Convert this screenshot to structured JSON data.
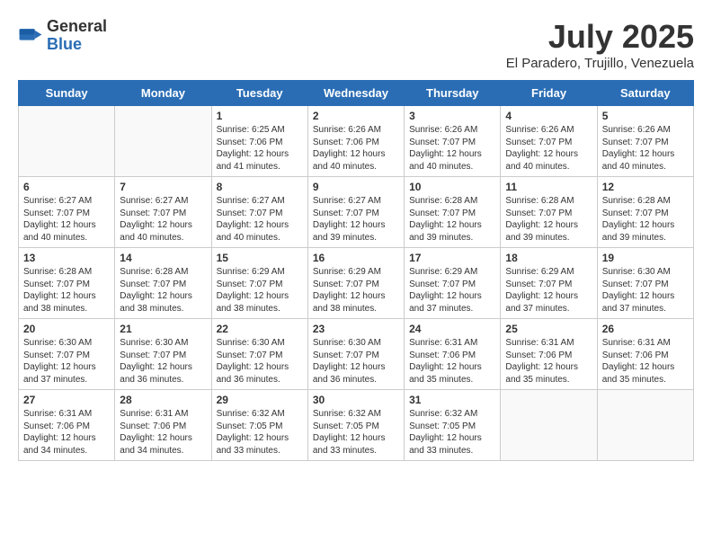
{
  "logo": {
    "general": "General",
    "blue": "Blue"
  },
  "title": "July 2025",
  "location": "El Paradero, Trujillo, Venezuela",
  "days_of_week": [
    "Sunday",
    "Monday",
    "Tuesday",
    "Wednesday",
    "Thursday",
    "Friday",
    "Saturday"
  ],
  "weeks": [
    [
      {
        "day": "",
        "info": ""
      },
      {
        "day": "",
        "info": ""
      },
      {
        "day": "1",
        "info": "Sunrise: 6:25 AM\nSunset: 7:06 PM\nDaylight: 12 hours and 41 minutes."
      },
      {
        "day": "2",
        "info": "Sunrise: 6:26 AM\nSunset: 7:06 PM\nDaylight: 12 hours and 40 minutes."
      },
      {
        "day": "3",
        "info": "Sunrise: 6:26 AM\nSunset: 7:07 PM\nDaylight: 12 hours and 40 minutes."
      },
      {
        "day": "4",
        "info": "Sunrise: 6:26 AM\nSunset: 7:07 PM\nDaylight: 12 hours and 40 minutes."
      },
      {
        "day": "5",
        "info": "Sunrise: 6:26 AM\nSunset: 7:07 PM\nDaylight: 12 hours and 40 minutes."
      }
    ],
    [
      {
        "day": "6",
        "info": "Sunrise: 6:27 AM\nSunset: 7:07 PM\nDaylight: 12 hours and 40 minutes."
      },
      {
        "day": "7",
        "info": "Sunrise: 6:27 AM\nSunset: 7:07 PM\nDaylight: 12 hours and 40 minutes."
      },
      {
        "day": "8",
        "info": "Sunrise: 6:27 AM\nSunset: 7:07 PM\nDaylight: 12 hours and 40 minutes."
      },
      {
        "day": "9",
        "info": "Sunrise: 6:27 AM\nSunset: 7:07 PM\nDaylight: 12 hours and 39 minutes."
      },
      {
        "day": "10",
        "info": "Sunrise: 6:28 AM\nSunset: 7:07 PM\nDaylight: 12 hours and 39 minutes."
      },
      {
        "day": "11",
        "info": "Sunrise: 6:28 AM\nSunset: 7:07 PM\nDaylight: 12 hours and 39 minutes."
      },
      {
        "day": "12",
        "info": "Sunrise: 6:28 AM\nSunset: 7:07 PM\nDaylight: 12 hours and 39 minutes."
      }
    ],
    [
      {
        "day": "13",
        "info": "Sunrise: 6:28 AM\nSunset: 7:07 PM\nDaylight: 12 hours and 38 minutes."
      },
      {
        "day": "14",
        "info": "Sunrise: 6:28 AM\nSunset: 7:07 PM\nDaylight: 12 hours and 38 minutes."
      },
      {
        "day": "15",
        "info": "Sunrise: 6:29 AM\nSunset: 7:07 PM\nDaylight: 12 hours and 38 minutes."
      },
      {
        "day": "16",
        "info": "Sunrise: 6:29 AM\nSunset: 7:07 PM\nDaylight: 12 hours and 38 minutes."
      },
      {
        "day": "17",
        "info": "Sunrise: 6:29 AM\nSunset: 7:07 PM\nDaylight: 12 hours and 37 minutes."
      },
      {
        "day": "18",
        "info": "Sunrise: 6:29 AM\nSunset: 7:07 PM\nDaylight: 12 hours and 37 minutes."
      },
      {
        "day": "19",
        "info": "Sunrise: 6:30 AM\nSunset: 7:07 PM\nDaylight: 12 hours and 37 minutes."
      }
    ],
    [
      {
        "day": "20",
        "info": "Sunrise: 6:30 AM\nSunset: 7:07 PM\nDaylight: 12 hours and 37 minutes."
      },
      {
        "day": "21",
        "info": "Sunrise: 6:30 AM\nSunset: 7:07 PM\nDaylight: 12 hours and 36 minutes."
      },
      {
        "day": "22",
        "info": "Sunrise: 6:30 AM\nSunset: 7:07 PM\nDaylight: 12 hours and 36 minutes."
      },
      {
        "day": "23",
        "info": "Sunrise: 6:30 AM\nSunset: 7:07 PM\nDaylight: 12 hours and 36 minutes."
      },
      {
        "day": "24",
        "info": "Sunrise: 6:31 AM\nSunset: 7:06 PM\nDaylight: 12 hours and 35 minutes."
      },
      {
        "day": "25",
        "info": "Sunrise: 6:31 AM\nSunset: 7:06 PM\nDaylight: 12 hours and 35 minutes."
      },
      {
        "day": "26",
        "info": "Sunrise: 6:31 AM\nSunset: 7:06 PM\nDaylight: 12 hours and 35 minutes."
      }
    ],
    [
      {
        "day": "27",
        "info": "Sunrise: 6:31 AM\nSunset: 7:06 PM\nDaylight: 12 hours and 34 minutes."
      },
      {
        "day": "28",
        "info": "Sunrise: 6:31 AM\nSunset: 7:06 PM\nDaylight: 12 hours and 34 minutes."
      },
      {
        "day": "29",
        "info": "Sunrise: 6:32 AM\nSunset: 7:05 PM\nDaylight: 12 hours and 33 minutes."
      },
      {
        "day": "30",
        "info": "Sunrise: 6:32 AM\nSunset: 7:05 PM\nDaylight: 12 hours and 33 minutes."
      },
      {
        "day": "31",
        "info": "Sunrise: 6:32 AM\nSunset: 7:05 PM\nDaylight: 12 hours and 33 minutes."
      },
      {
        "day": "",
        "info": ""
      },
      {
        "day": "",
        "info": ""
      }
    ]
  ]
}
